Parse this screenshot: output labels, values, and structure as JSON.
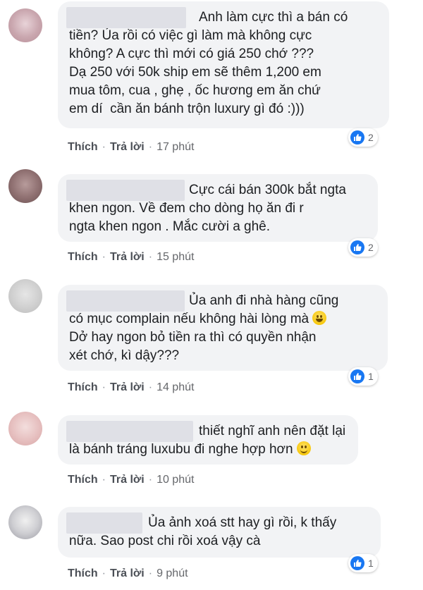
{
  "like_color": "#1877f2",
  "bubble_color": "#f2f3f5",
  "comments": [
    {
      "lines": [
        "Anh làm cực thì a bán có",
        "tiền? Ủa rồi có việc gì làm mà không cực",
        "không? A cực thì mới có giá 250 chớ ???",
        "Dạ 250 với 50k ship em sẽ thêm 1,200 em",
        "mua tôm, cua , ghẹ , ốc hương em ăn chứ",
        "em dí  cần ăn bánh trộn luxury gì đó :)))"
      ],
      "like_label": "Thích",
      "reply_label": "Trả lời",
      "time": "17 phút",
      "reactions": "2"
    },
    {
      "lines": [
        "Cực cái bán 300k bắt ngta",
        "khen ngon. Về đem cho dòng họ ăn đi r",
        "ngta khen ngon . Mắc cười a ghê."
      ],
      "like_label": "Thích",
      "reply_label": "Trả lời",
      "time": "15 phút",
      "reactions": "2"
    },
    {
      "lines": [
        "Ủa anh đi nhà hàng cũng",
        "có mục complain nếu không hài lòng mà",
        "Dở hay ngon bỏ tiền ra thì có quyền nhận",
        "xét chớ, kì dậy???"
      ],
      "like_label": "Thích",
      "reply_label": "Trả lời",
      "time": "14 phút",
      "reactions": "1"
    },
    {
      "lines": [
        "thiết nghĩ anh nên đặt lại",
        "là bánh tráng luxubu đi nghe hợp hơn"
      ],
      "like_label": "Thích",
      "reply_label": "Trả lời",
      "time": "10 phút",
      "reactions": ""
    },
    {
      "lines": [
        "Ủa ảnh xoá stt hay gì rồi, k thấy",
        "nữa. Sao post chi rồi xoá vậy cà"
      ],
      "like_label": "Thích",
      "reply_label": "Trả lời",
      "time": "9 phút",
      "reactions": "1"
    }
  ]
}
